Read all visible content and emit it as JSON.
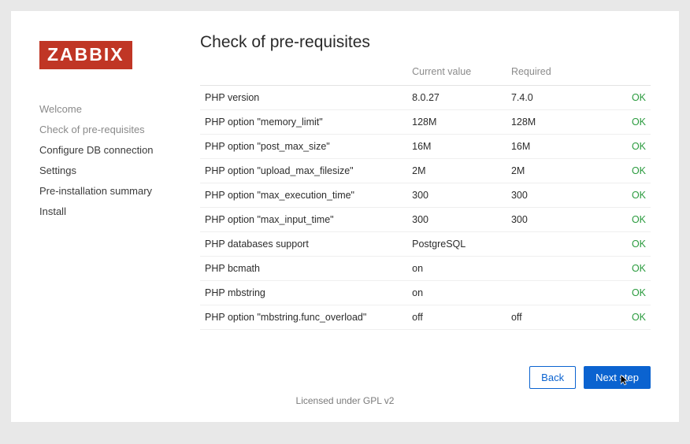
{
  "brand": "ZABBIX",
  "title": "Check of pre-requisites",
  "nav": [
    {
      "label": "Welcome",
      "state": "done"
    },
    {
      "label": "Check of pre-requisites",
      "state": "active"
    },
    {
      "label": "Configure DB connection",
      "state": "todo"
    },
    {
      "label": "Settings",
      "state": "todo"
    },
    {
      "label": "Pre-installation summary",
      "state": "todo"
    },
    {
      "label": "Install",
      "state": "todo"
    }
  ],
  "columns": {
    "name": "",
    "current": "Current value",
    "required": "Required",
    "status": ""
  },
  "rows": [
    {
      "name": "PHP version",
      "current": "8.0.27",
      "required": "7.4.0",
      "status": "OK"
    },
    {
      "name": "PHP option \"memory_limit\"",
      "current": "128M",
      "required": "128M",
      "status": "OK"
    },
    {
      "name": "PHP option \"post_max_size\"",
      "current": "16M",
      "required": "16M",
      "status": "OK"
    },
    {
      "name": "PHP option \"upload_max_filesize\"",
      "current": "2M",
      "required": "2M",
      "status": "OK"
    },
    {
      "name": "PHP option \"max_execution_time\"",
      "current": "300",
      "required": "300",
      "status": "OK"
    },
    {
      "name": "PHP option \"max_input_time\"",
      "current": "300",
      "required": "300",
      "status": "OK"
    },
    {
      "name": "PHP databases support",
      "current": "PostgreSQL",
      "required": "",
      "status": "OK"
    },
    {
      "name": "PHP bcmath",
      "current": "on",
      "required": "",
      "status": "OK"
    },
    {
      "name": "PHP mbstring",
      "current": "on",
      "required": "",
      "status": "OK"
    },
    {
      "name": "PHP option \"mbstring.func_overload\"",
      "current": "off",
      "required": "off",
      "status": "OK"
    }
  ],
  "buttons": {
    "back": "Back",
    "next": "Next step"
  },
  "footer": "Licensed under GPL v2"
}
